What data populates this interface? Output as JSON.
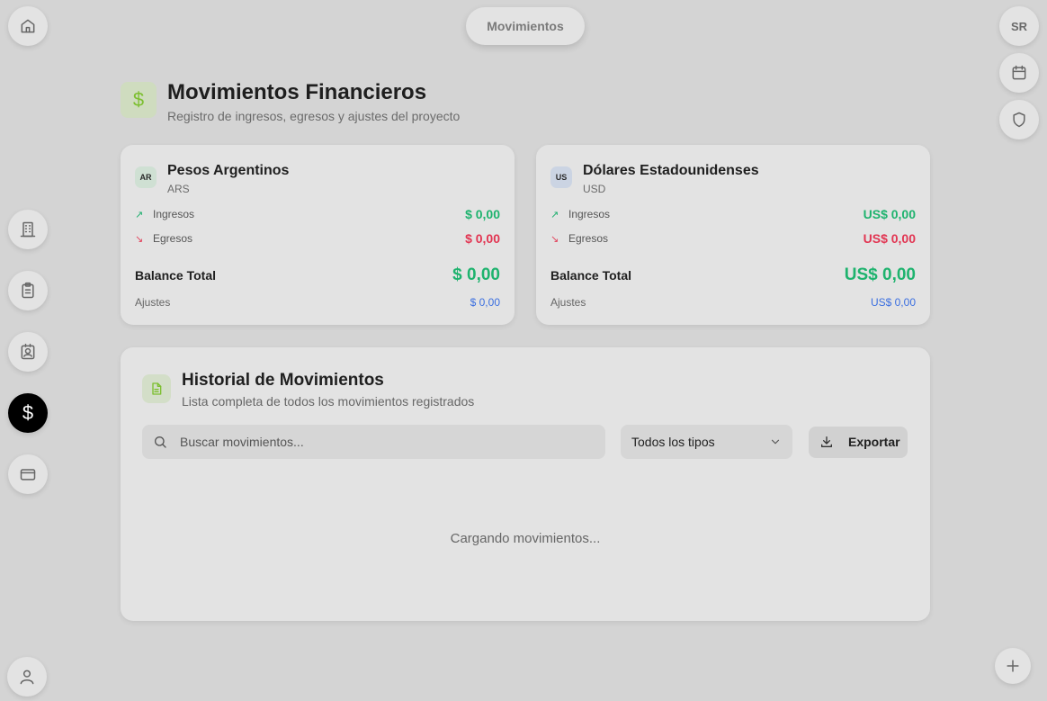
{
  "top_pill": {
    "label": "Movimientos"
  },
  "user": {
    "initials": "SR"
  },
  "nav": {
    "active_glyph": "$"
  },
  "header": {
    "glyph": "$",
    "title": "Movimientos Financieros",
    "subtitle": "Registro de ingresos, egresos y ajustes del proyecto"
  },
  "cards": [
    {
      "badge": "AR",
      "name": "Pesos Argentinos",
      "code": "ARS",
      "ingresos_label": "Ingresos",
      "ingresos_value": "$ 0,00",
      "egresos_label": "Egresos",
      "egresos_value": "$ 0,00",
      "balance_label": "Balance Total",
      "balance_value": "$ 0,00",
      "ajustes_label": "Ajustes",
      "ajustes_value": "$ 0,00"
    },
    {
      "badge": "US",
      "name": "Dólares Estadounidenses",
      "code": "USD",
      "ingresos_label": "Ingresos",
      "ingresos_value": "US$ 0,00",
      "egresos_label": "Egresos",
      "egresos_value": "US$ 0,00",
      "balance_label": "Balance Total",
      "balance_value": "US$ 0,00",
      "ajustes_label": "Ajustes",
      "ajustes_value": "US$ 0,00"
    }
  ],
  "history": {
    "title": "Historial de Movimientos",
    "subtitle": "Lista completa de todos los movimientos registrados",
    "search_placeholder": "Buscar movimientos...",
    "filter_value": "Todos los tipos",
    "export_label": "Exportar",
    "loading_text": "Cargando movimientos..."
  },
  "colors": {
    "background": "#d4d4d4",
    "income": "#1eb36e",
    "expense": "#e23552",
    "adjust": "#3b6fe0",
    "accent": "#7cbf2f"
  },
  "icons": {
    "left_nav": [
      "home-icon",
      "building-icon",
      "clipboard-icon",
      "contact-icon",
      "dollar-icon",
      "card-icon",
      "user-icon"
    ],
    "right_nav": [
      "calendar-icon",
      "shield-icon",
      "plus-icon"
    ]
  }
}
